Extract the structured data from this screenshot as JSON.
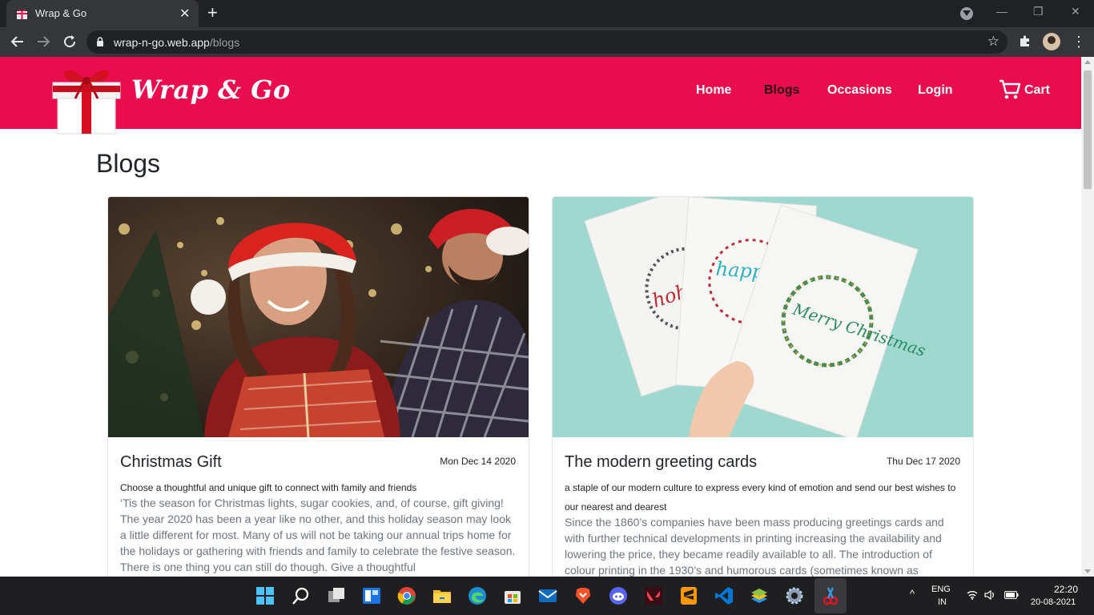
{
  "browser": {
    "tab_title": "Wrap & Go",
    "tab_close": "✕",
    "new_tab": "+",
    "url_host": "wrap-n-go.web.app",
    "url_path": "/blogs",
    "star": "☆",
    "menu": "⋮",
    "win_min": "—",
    "win_restore": "❐",
    "win_close": "✕"
  },
  "site": {
    "brand": "Wrap & Go",
    "nav": {
      "home": "Home",
      "blogs": "Blogs",
      "occasions": "Occasions",
      "login": "Login",
      "cart": "Cart"
    },
    "colors": {
      "header_bg": "#e90c4e",
      "active_link": "#2b0d16"
    }
  },
  "page": {
    "heading": "Blogs",
    "blogs": [
      {
        "title": "Christmas Gift",
        "date": "Mon Dec 14 2020",
        "subtitle": "Choose a thoughtful and unique gift to connect with family and friends",
        "body": "‘Tis the season for Christmas lights, sugar cookies, and, of course, gift giving! The year 2020 has been a year like no other, and this holiday season may look a little different for most. Many of us will not be taking our annual trips home for the holidays or gathering with friends and family to celebrate the festive season. There is one thing you can still do though. Give a thoughtful"
      },
      {
        "title": "The modern greeting cards",
        "date": "Thu Dec 17 2020",
        "subtitle": "a staple of our modern culture to express every kind of emotion and send our best wishes to our nearest and dearest",
        "body": "Since the 1860’s companies have been mass producing greetings cards and with further technical developments in printing increasing the availability and lowering the price, they became readily available to all. The introduction of colour printing in the 1930’s and humorous cards (sometimes known as",
        "card_texts": [
          "hohoho",
          "happy holid",
          "Merry Christmas"
        ]
      }
    ]
  },
  "taskbar": {
    "icons": [
      "windows-start-icon",
      "search-icon",
      "task-view-icon",
      "widgets-icon",
      "chrome-icon",
      "file-explorer-icon",
      "edge-icon",
      "store-icon",
      "mail-icon",
      "brave-icon",
      "discord-icon",
      "valorant-icon",
      "sublime-text-icon",
      "vscode-icon",
      "bluestacks-icon",
      "settings-icon",
      "snipping-tool-icon"
    ],
    "chevron": "^",
    "lang_line1": "ENG",
    "lang_line2": "IN",
    "time": "22:20",
    "date": "20-08-2021"
  }
}
